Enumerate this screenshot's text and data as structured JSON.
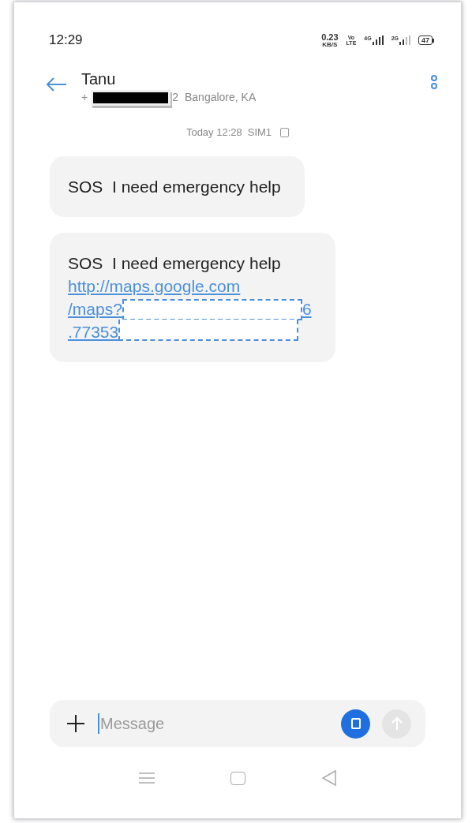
{
  "status_bar": {
    "time": "12:29",
    "speed": "0.23",
    "speed_unit": "KB/S",
    "volte_top": "Vo",
    "volte_bottom": "LTE",
    "network_1": "4G",
    "network_2": "2G",
    "battery": "47"
  },
  "header": {
    "name": "Tanu",
    "phone_prefix": "+",
    "phone_suffix": "2",
    "location": "Bangalore, KA"
  },
  "timestamp": {
    "text": "Today 12:28",
    "sim": "SIM1"
  },
  "messages": [
    {
      "text": "SOS  I need emergency help"
    },
    {
      "text": "SOS  I need emergency help",
      "link_lines": [
        {
          "kind": "plain",
          "before": "http://maps.google.com"
        },
        {
          "kind": "redactedtop",
          "before": "/maps?",
          "after": "6"
        },
        {
          "kind": "redactedbottom",
          "before": ".77353"
        }
      ]
    }
  ],
  "composer": {
    "placeholder": "Message"
  }
}
